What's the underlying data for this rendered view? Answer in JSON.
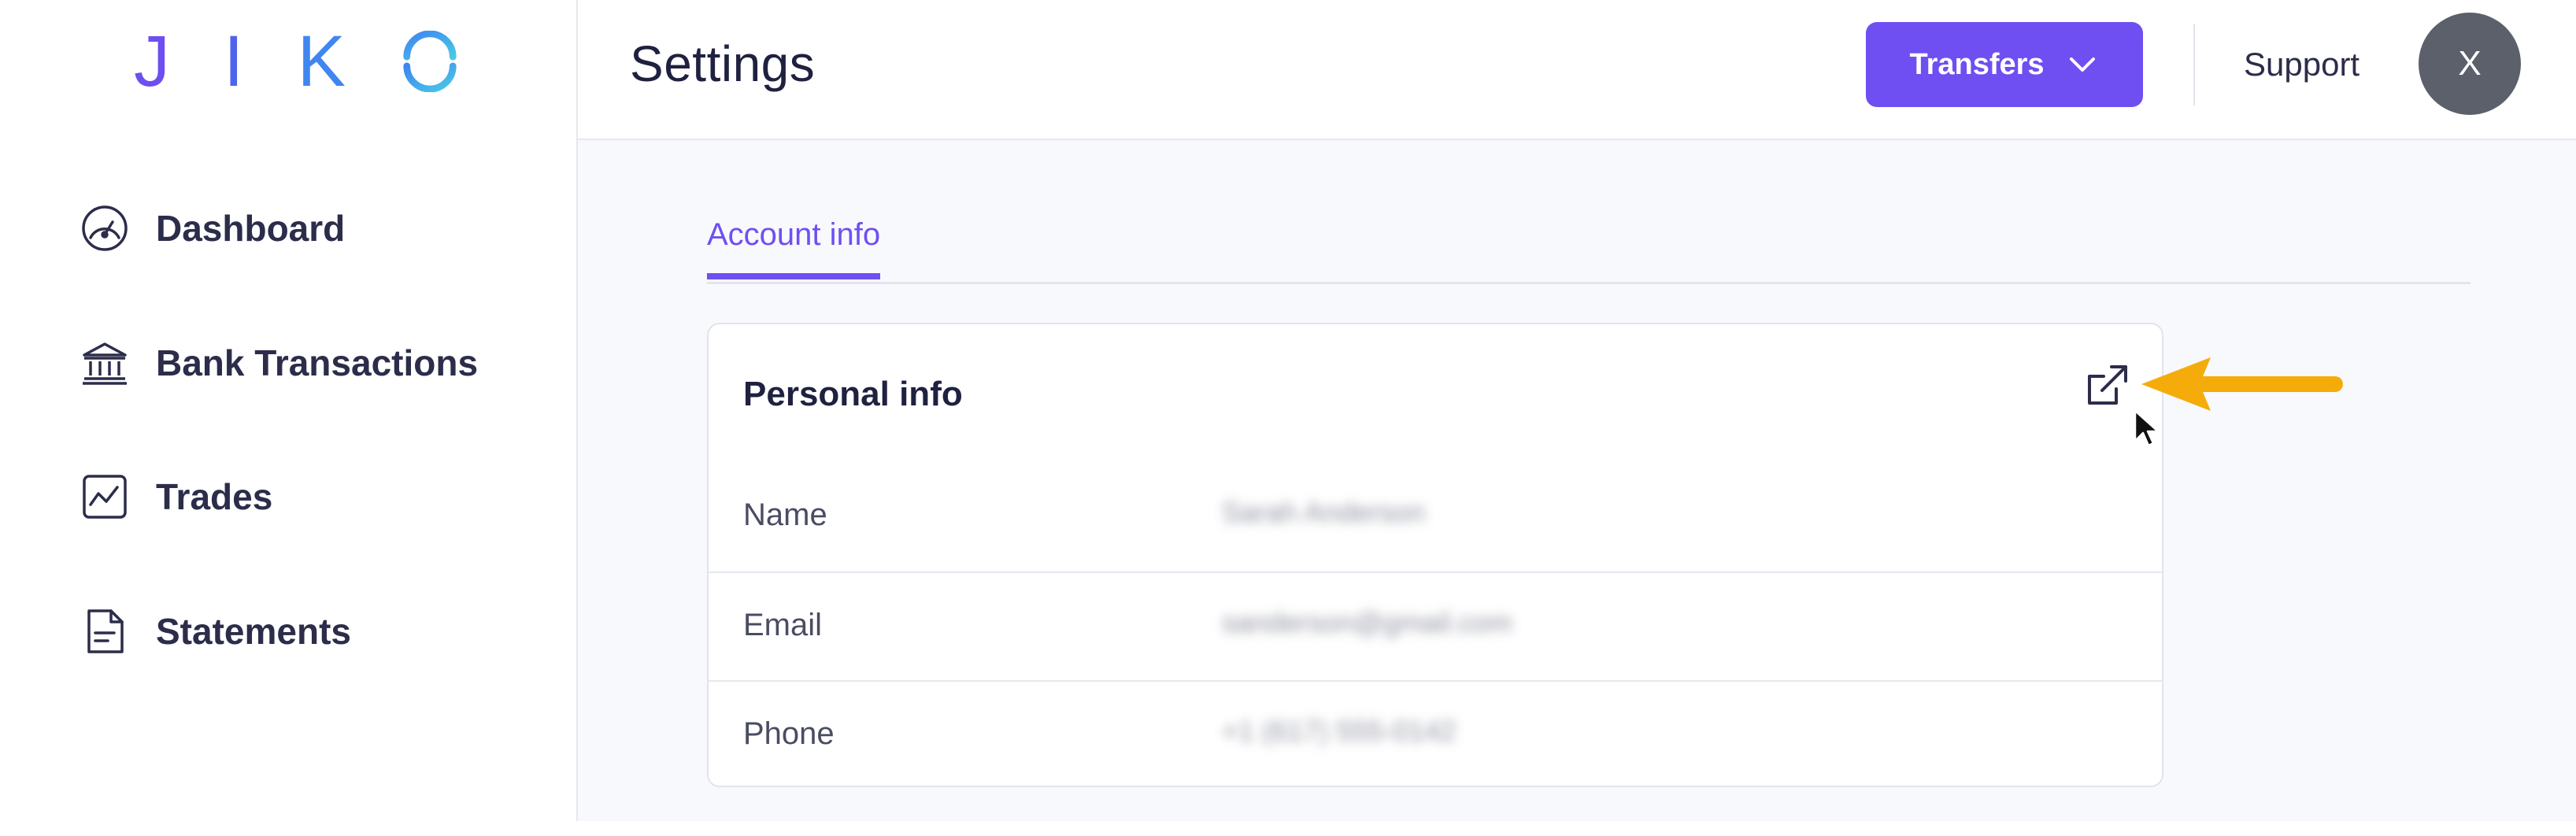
{
  "sidebar": {
    "logo_letters": [
      "J",
      "I",
      "K"
    ],
    "items": [
      {
        "label": "Dashboard",
        "icon": "gauge-icon"
      },
      {
        "label": "Bank Transactions",
        "icon": "bank-icon"
      },
      {
        "label": "Trades",
        "icon": "chart-line-icon"
      },
      {
        "label": "Statements",
        "icon": "document-icon"
      }
    ]
  },
  "header": {
    "title": "Settings",
    "transfers_label": "Transfers",
    "support_label": "Support",
    "avatar_initial": "X"
  },
  "tabs": {
    "active_label": "Account info"
  },
  "personal_info": {
    "title": "Personal info",
    "rows": [
      {
        "label": "Name",
        "value": "Sarah Anderson"
      },
      {
        "label": "Email",
        "value": "sanderson@gmail.com"
      },
      {
        "label": "Phone",
        "value": "+1 (617) 555-0142"
      }
    ]
  },
  "colors": {
    "accent": "#6f4ff2",
    "avatar_bg": "#5c606b",
    "annotation_arrow": "#f5ac0a",
    "logo_gradient": [
      "#6d4ef0",
      "#3f86ef",
      "#49c8e8"
    ]
  }
}
